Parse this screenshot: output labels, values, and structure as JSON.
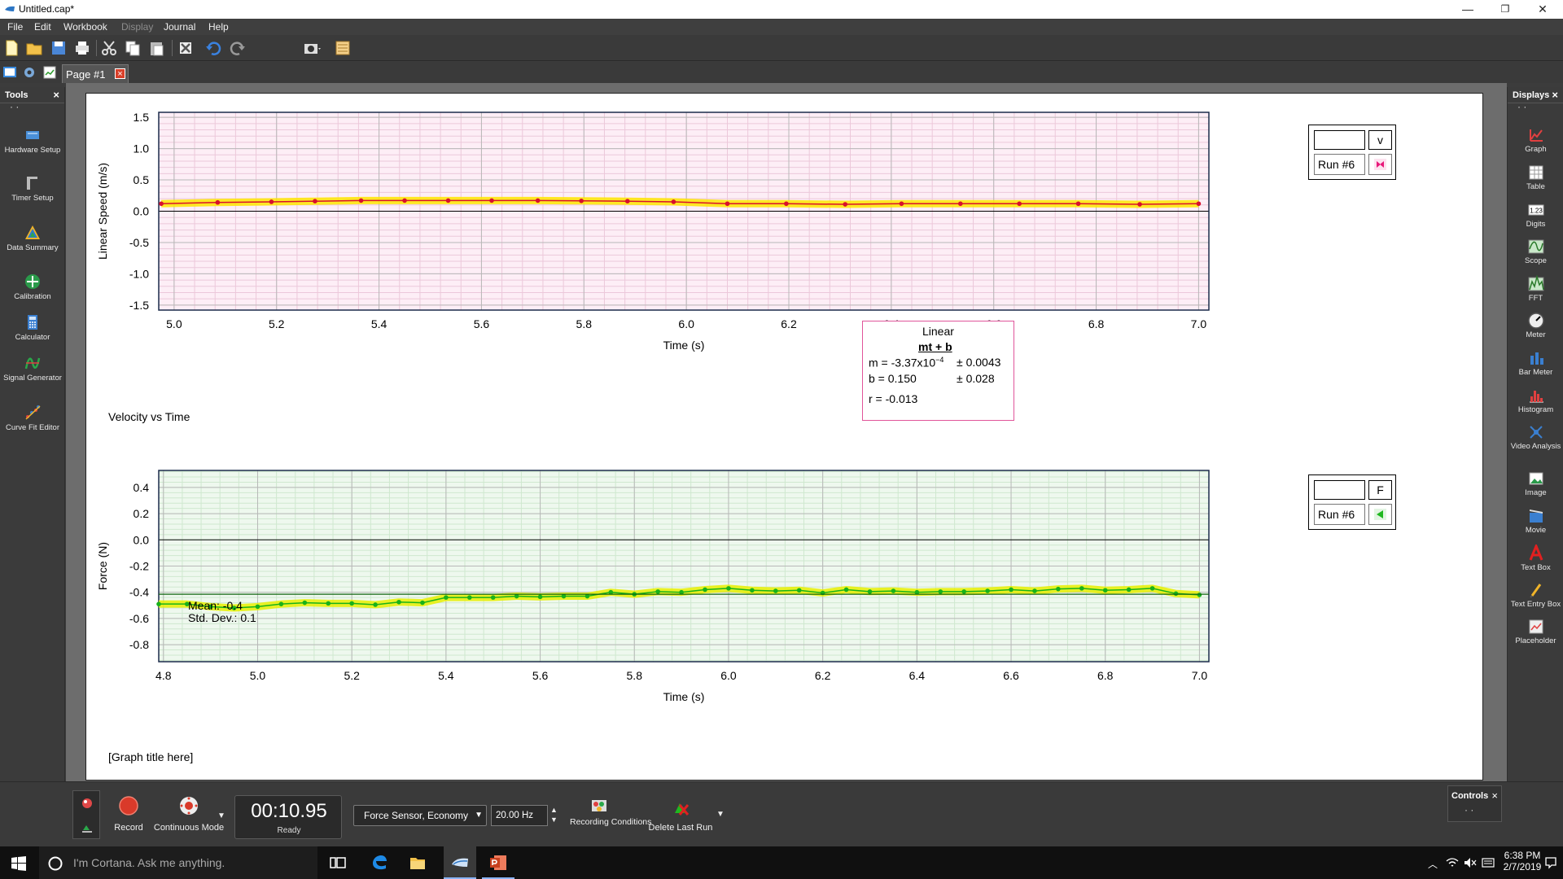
{
  "window": {
    "title": "Untitled.cap*",
    "minimize": "—",
    "restore": "❐",
    "close": "✕"
  },
  "menu": [
    {
      "label": "File",
      "enabled": true
    },
    {
      "label": "Edit",
      "enabled": true
    },
    {
      "label": "Workbook",
      "enabled": true
    },
    {
      "label": "Display",
      "enabled": false
    },
    {
      "label": "Journal",
      "enabled": true
    },
    {
      "label": "Help",
      "enabled": true
    }
  ],
  "tabs": {
    "page_label": "Page #1",
    "close_glyph": "×"
  },
  "tools_panel": {
    "title": "Tools",
    "close": "×",
    "dots": "· ·",
    "items": [
      {
        "label": "Hardware Setup",
        "icon": "hardware-setup-icon"
      },
      {
        "label": "Timer Setup",
        "icon": "timer-setup-icon"
      },
      {
        "label": "Data Summary",
        "icon": "data-summary-icon"
      },
      {
        "label": "Calibration",
        "icon": "calibration-icon"
      },
      {
        "label": "Calculator",
        "icon": "calculator-icon"
      },
      {
        "label": "Signal Generator",
        "icon": "signal-generator-icon"
      },
      {
        "label": "Curve Fit Editor",
        "icon": "curve-fit-editor-icon"
      }
    ]
  },
  "displays_panel": {
    "title": "Displays",
    "close": "×",
    "dots": "· ·",
    "items": [
      {
        "label": "Graph",
        "icon": "graph-icon"
      },
      {
        "label": "Table",
        "icon": "table-icon"
      },
      {
        "label": "Digits",
        "icon": "digits-icon"
      },
      {
        "label": "Scope",
        "icon": "scope-icon"
      },
      {
        "label": "FFT",
        "icon": "fft-icon"
      },
      {
        "label": "Meter",
        "icon": "meter-icon"
      },
      {
        "label": "Bar Meter",
        "icon": "bar-meter-icon"
      },
      {
        "label": "Histogram",
        "icon": "histogram-icon"
      },
      {
        "label": "Video Analysis",
        "icon": "video-analysis-icon"
      },
      {
        "label": "Image",
        "icon": "image-icon"
      },
      {
        "label": "Movie",
        "icon": "movie-icon"
      },
      {
        "label": "Text Box",
        "icon": "text-box-icon"
      },
      {
        "label": "Text Entry Box",
        "icon": "text-entry-box-icon"
      },
      {
        "label": "Placeholder",
        "icon": "placeholder-icon"
      }
    ]
  },
  "graph1": {
    "title": "Velocity vs Time",
    "legend": {
      "variable": "v",
      "run": "Run #6",
      "marker_color": "#e8197a"
    },
    "fit": {
      "name": "Linear",
      "equation": "mt + b",
      "m_label": "m = -3.37x10",
      "m_exp": "−4",
      "m_err": "± 0.0043",
      "b_label": "b  = 0.150",
      "b_err": "± 0.028",
      "r_label": "r = -0.013"
    },
    "colors": {
      "series": "#d8102c",
      "highlight": "#ffe600",
      "background": "#fdeef6"
    }
  },
  "graph2": {
    "title": "[Graph title here]",
    "legend": {
      "variable": "F",
      "run": "Run #6",
      "marker_color": "#1fb81f"
    },
    "stats": {
      "mean": "Mean: -0.4",
      "stddev": "Std. Dev.: 0.1"
    },
    "colors": {
      "series": "#19b219",
      "highlight": "#e8f000",
      "background": "#eef8ee"
    }
  },
  "chart_data": [
    {
      "type": "line",
      "xlabel": "Time (s)",
      "ylabel": "Linear Speed (m/s)",
      "xlim": [
        4.97,
        7.02
      ],
      "ylim": [
        -1.58,
        1.58
      ],
      "x_ticks": [
        5.0,
        5.2,
        5.4,
        5.6,
        5.8,
        6.0,
        6.2,
        6.4,
        6.6,
        6.8,
        7.0
      ],
      "y_ticks": [
        1.5,
        1.0,
        0.5,
        0.0,
        -0.5,
        -1.0,
        -1.5
      ],
      "grid": true,
      "series": [
        {
          "x": [
            4.975,
            5.085,
            5.19,
            5.275,
            5.365,
            5.45,
            5.535,
            5.62,
            5.71,
            5.795,
            5.885,
            5.975,
            6.08,
            6.195,
            6.31,
            6.42,
            6.535,
            6.65,
            6.765,
            6.885,
            7.0
          ],
          "y": [
            0.12,
            0.14,
            0.15,
            0.16,
            0.17,
            0.17,
            0.17,
            0.17,
            0.17,
            0.165,
            0.16,
            0.15,
            0.12,
            0.12,
            0.11,
            0.12,
            0.12,
            0.12,
            0.12,
            0.11,
            0.12
          ]
        }
      ]
    },
    {
      "type": "line",
      "xlabel": "Time (s)",
      "ylabel": "Force (N)",
      "xlim": [
        4.79,
        7.02
      ],
      "ylim": [
        -0.93,
        0.53
      ],
      "x_ticks": [
        4.8,
        5.0,
        5.2,
        5.4,
        5.6,
        5.8,
        6.0,
        6.2,
        6.4,
        6.6,
        6.8,
        7.0
      ],
      "y_ticks": [
        0.4,
        0.2,
        0.0,
        -0.2,
        -0.4,
        -0.6,
        -0.8
      ],
      "grid": true,
      "series": [
        {
          "x": [
            4.79,
            4.85,
            4.9,
            4.95,
            5.0,
            5.05,
            5.1,
            5.15,
            5.2,
            5.25,
            5.3,
            5.35,
            5.4,
            5.45,
            5.5,
            5.55,
            5.6,
            5.65,
            5.7,
            5.75,
            5.8,
            5.85,
            5.9,
            5.95,
            6.0,
            6.05,
            6.1,
            6.15,
            6.2,
            6.25,
            6.3,
            6.35,
            6.4,
            6.45,
            6.5,
            6.55,
            6.6,
            6.65,
            6.7,
            6.75,
            6.8,
            6.85,
            6.9,
            6.95,
            7.0
          ],
          "y": [
            -0.49,
            -0.49,
            -0.51,
            -0.52,
            -0.51,
            -0.49,
            -0.48,
            -0.485,
            -0.485,
            -0.495,
            -0.475,
            -0.48,
            -0.44,
            -0.44,
            -0.44,
            -0.43,
            -0.435,
            -0.43,
            -0.43,
            -0.4,
            -0.415,
            -0.395,
            -0.4,
            -0.38,
            -0.37,
            -0.385,
            -0.39,
            -0.385,
            -0.405,
            -0.38,
            -0.395,
            -0.39,
            -0.4,
            -0.395,
            -0.395,
            -0.39,
            -0.38,
            -0.39,
            -0.375,
            -0.37,
            -0.385,
            -0.38,
            -0.37,
            -0.41,
            -0.42
          ]
        }
      ]
    }
  ],
  "controls": {
    "record": "Record",
    "continuous_mode": "Continuous Mode",
    "timer": "00:10.95",
    "status": "Ready",
    "sensor": "Force Sensor, Economy",
    "rate": "20.00 Hz",
    "recording_conditions": "Recording Conditions",
    "delete_last_run": "Delete Last Run",
    "panel_title": "Controls",
    "panel_close": "×",
    "panel_dots": "· ·"
  },
  "taskbar": {
    "search_placeholder": "I'm Cortana. Ask me anything.",
    "time": "6:38 PM",
    "date": "2/7/2019"
  }
}
